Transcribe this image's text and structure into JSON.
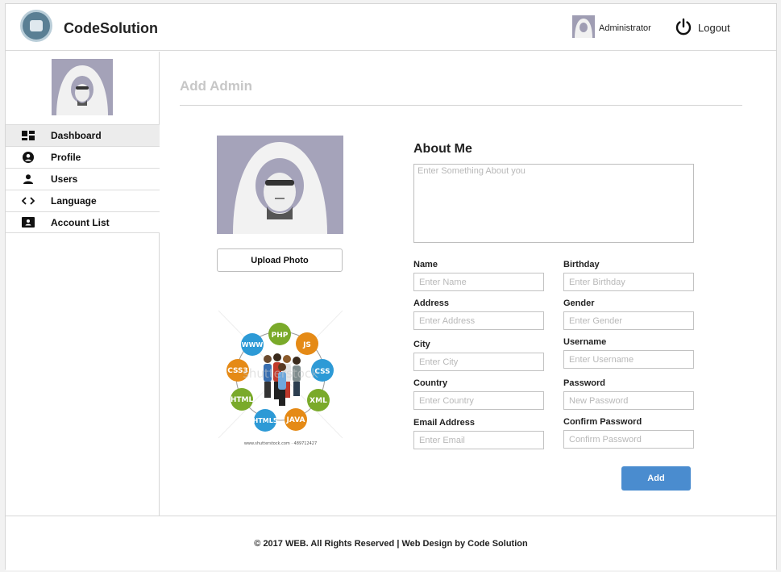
{
  "header": {
    "brand": "CodeSolution",
    "user_name": "Administrator",
    "logout_label": "Logout"
  },
  "sidebar": {
    "items": [
      {
        "label": "Dashboard",
        "icon": "dashboard-icon",
        "active": true
      },
      {
        "label": "Profile",
        "icon": "profile-icon",
        "active": false
      },
      {
        "label": "Users",
        "icon": "user-icon",
        "active": false
      },
      {
        "label": "Language",
        "icon": "code-icon",
        "active": false
      },
      {
        "label": "Account List",
        "icon": "account-card-icon",
        "active": false
      }
    ]
  },
  "main": {
    "page_title": "Add Admin",
    "upload_label": "Upload Photo",
    "stock_image": {
      "watermark": "shutterstock",
      "caption": "www.shutterstock.com · 489712427",
      "badges": [
        "PHP",
        "JS",
        "CSS",
        "XML",
        "JAVA",
        "HTML5",
        "HTML",
        "CSS3",
        "WWW"
      ]
    },
    "about": {
      "title": "About Me",
      "placeholder": "Enter Something About you",
      "value": ""
    },
    "fields": {
      "name": {
        "label": "Name",
        "placeholder": "Enter Name",
        "value": ""
      },
      "birthday": {
        "label": "Birthday",
        "placeholder": "Enter Birthday",
        "value": ""
      },
      "address": {
        "label": "Address",
        "placeholder": "Enter Address",
        "value": ""
      },
      "gender": {
        "label": "Gender",
        "placeholder": "Enter Gender",
        "value": ""
      },
      "city": {
        "label": "City",
        "placeholder": "Enter City",
        "value": ""
      },
      "username": {
        "label": "Username",
        "placeholder": "Enter Username",
        "value": ""
      },
      "country": {
        "label": "Country",
        "placeholder": "Enter Country",
        "value": ""
      },
      "password": {
        "label": "Password",
        "placeholder": "New Password",
        "value": ""
      },
      "email": {
        "label": "Email Address",
        "placeholder": "Enter Email",
        "value": ""
      },
      "confirm_password": {
        "label": "Confirm Password",
        "placeholder": "Confirm Password",
        "value": ""
      }
    },
    "submit_label": "Add"
  },
  "footer": {
    "text": "© 2017 WEB. All Rights Reserved | Web Design by Code Solution"
  },
  "colors": {
    "accent": "#4a8ccf",
    "title_gray": "#c7c7c7",
    "avatar_bg": "#a5a3ba"
  }
}
